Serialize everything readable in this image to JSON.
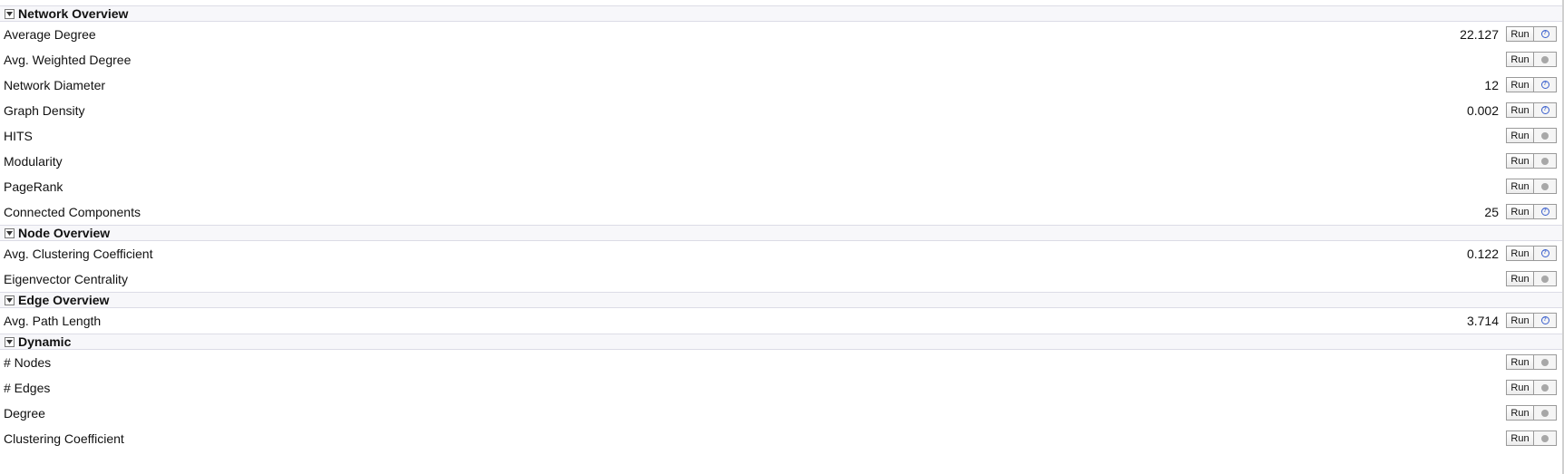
{
  "sections": [
    {
      "title": "Network Overview",
      "rows": [
        {
          "label": "Average Degree",
          "value": "22.127",
          "aux": "help"
        },
        {
          "label": "Avg. Weighted Degree",
          "value": "",
          "aux": "dot"
        },
        {
          "label": "Network Diameter",
          "value": "12",
          "aux": "help"
        },
        {
          "label": "Graph Density",
          "value": "0.002",
          "aux": "help"
        },
        {
          "label": "HITS",
          "value": "",
          "aux": "dot"
        },
        {
          "label": "Modularity",
          "value": "",
          "aux": "dot"
        },
        {
          "label": "PageRank",
          "value": "",
          "aux": "dot"
        },
        {
          "label": "Connected Components",
          "value": "25",
          "aux": "help"
        }
      ]
    },
    {
      "title": "Node Overview",
      "rows": [
        {
          "label": "Avg. Clustering Coefficient",
          "value": "0.122",
          "aux": "help"
        },
        {
          "label": "Eigenvector Centrality",
          "value": "",
          "aux": "dot"
        }
      ]
    },
    {
      "title": "Edge Overview",
      "rows": [
        {
          "label": "Avg. Path Length",
          "value": "3.714",
          "aux": "help"
        }
      ]
    },
    {
      "title": "Dynamic",
      "rows": [
        {
          "label": "# Nodes",
          "value": "",
          "aux": "dot"
        },
        {
          "label": "# Edges",
          "value": "",
          "aux": "dot"
        },
        {
          "label": "Degree",
          "value": "",
          "aux": "dot"
        },
        {
          "label": "Clustering Coefficient",
          "value": "",
          "aux": "dot"
        }
      ]
    }
  ],
  "run_label": "Run",
  "help_glyph": "?",
  "icons": {
    "collapse": "triangle-down-icon",
    "help": "help-icon",
    "status": "status-dot-icon"
  },
  "colors": {
    "header_bg": "#f7f7fa",
    "help_blue": "#3a5fcd",
    "dot_gray": "#a7a7a7"
  }
}
